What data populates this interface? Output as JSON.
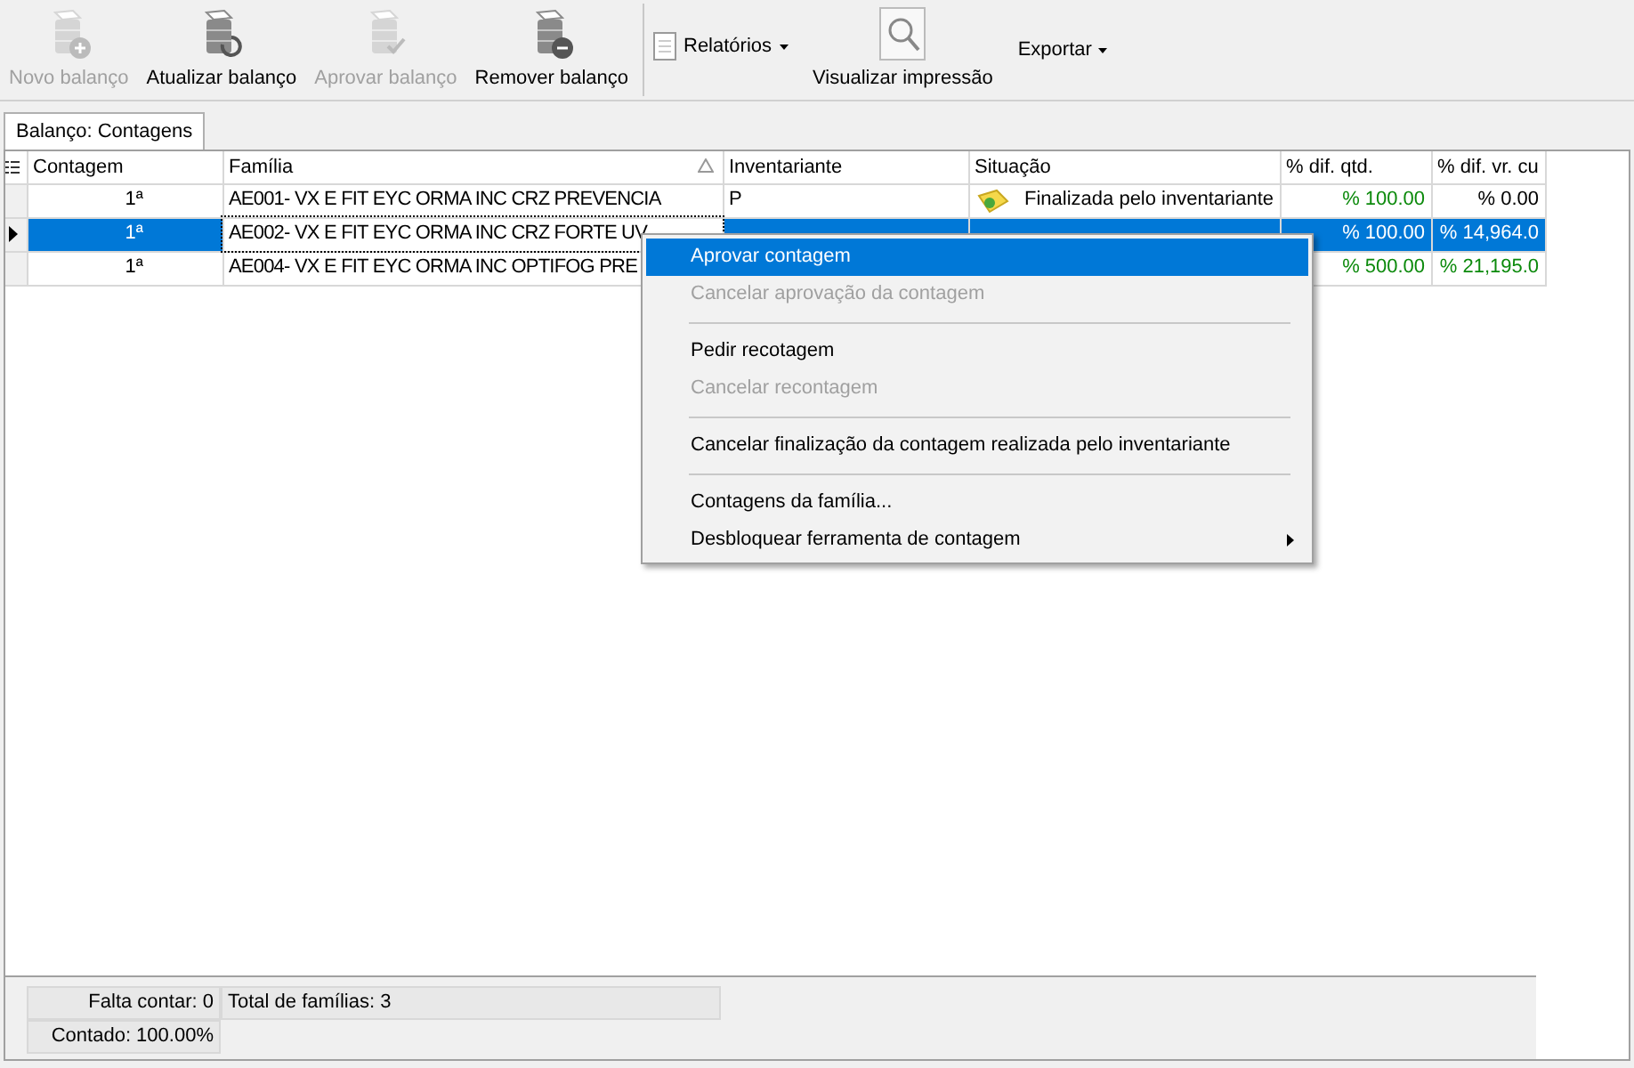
{
  "toolbar": {
    "buttons": [
      {
        "label": "Novo balanço",
        "disabled": true,
        "kind": "new"
      },
      {
        "label": "Atualizar balanço",
        "disabled": false,
        "kind": "refresh"
      },
      {
        "label": "Aprovar balanço",
        "disabled": true,
        "kind": "approve"
      },
      {
        "label": "Remover balanço",
        "disabled": false,
        "kind": "remove"
      }
    ],
    "reports": {
      "label": "Relatórios"
    },
    "preview": {
      "label": "Visualizar impressão"
    },
    "export": {
      "label": "Exportar"
    }
  },
  "tabs": [
    {
      "label": "Balanço: Contagens",
      "selected": true
    }
  ],
  "table": {
    "columns": [
      "Contagem",
      "Família",
      "Inventariante",
      "Situação",
      "% dif. qtd.",
      "% dif. vr. cu"
    ],
    "rows": [
      {
        "selected": false,
        "contagem": "1ª",
        "familia": "AE001- VX E FIT EYC ORMA INC CRZ PREVENCIA",
        "inventariante": "P",
        "situacao": "Finalizada pelo inventariante",
        "dif_qtd": "% 100.00",
        "dif_vr": {
          "text": "% 0.00",
          "green": false
        }
      },
      {
        "selected": true,
        "contagem": "1ª",
        "familia": "AE002- VX E FIT EYC ORMA INC CRZ FORTE UV",
        "dif_qtd": "% 100.00",
        "dif_vr": {
          "text": "% 14,964.0"
        }
      },
      {
        "selected": false,
        "contagem": "1ª",
        "familia": "AE004- VX E FIT EYC ORMA INC OPTIFOG PRE",
        "dif_qtd": "% 500.00",
        "dif_vr": {
          "text": "% 21,195.0",
          "green": true
        }
      }
    ]
  },
  "context_menu": {
    "groups": [
      [
        {
          "label": "Aprovar contagem",
          "selected": true,
          "disabled": false
        },
        {
          "label": "Cancelar aprovação da contagem",
          "selected": false,
          "disabled": true
        }
      ],
      [
        {
          "label": "Pedir recotagem",
          "selected": false,
          "disabled": false
        },
        {
          "label": "Cancelar recontagem",
          "selected": false,
          "disabled": true
        }
      ],
      [
        {
          "label": "Cancelar finalização da contagem realizada pelo inventariante",
          "selected": false,
          "disabled": false
        }
      ],
      [
        {
          "label": "Contagens da família...",
          "selected": false,
          "disabled": false
        },
        {
          "label": "Desbloquear ferramenta de contagem",
          "selected": false,
          "disabled": false,
          "submenu": true
        }
      ]
    ]
  },
  "status_bar": {
    "pending": "Falta contar: 0",
    "total": "Total de famílias: 3",
    "counted": "Contado: 100.00%"
  }
}
